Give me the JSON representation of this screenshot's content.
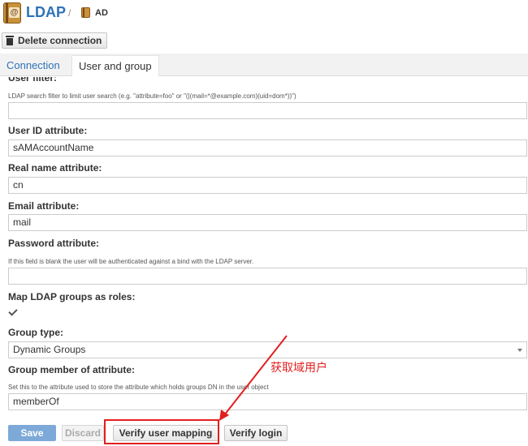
{
  "header": {
    "app_title": "LDAP",
    "breadcrumb_sep": "/",
    "breadcrumb_item": "AD",
    "app_icon_glyph": "@"
  },
  "toolbar": {
    "delete_label": "Delete connection"
  },
  "tabs": [
    {
      "label": "Connection",
      "active": false
    },
    {
      "label": "User and group",
      "active": true
    }
  ],
  "form": {
    "user_filter": {
      "label": "User filter:",
      "hint": "LDAP search filter to limit user search (e.g. \"attribute=foo\" or \"(|(mail=*@example.com)(uid=dom*))\")",
      "value": ""
    },
    "user_id": {
      "label": "User ID attribute:",
      "value": "sAMAccountName"
    },
    "real_name": {
      "label": "Real name attribute:",
      "value": "cn"
    },
    "email": {
      "label": "Email attribute:",
      "value": "mail"
    },
    "password": {
      "label": "Password attribute:",
      "hint": "If this field is blank the user will be authenticated against a bind with the LDAP server.",
      "value": ""
    },
    "map_groups": {
      "label": "Map LDAP groups as roles:",
      "checked": true
    },
    "group_type": {
      "label": "Group type:",
      "value": "Dynamic Groups"
    },
    "group_member": {
      "label": "Group member of attribute:",
      "hint": "Set this to the attribute used to store the attribute which holds groups DN in the user object",
      "value": "memberOf"
    }
  },
  "buttons": {
    "save": "Save",
    "discard": "Discard",
    "verify_mapping": "Verify user mapping",
    "verify_login": "Verify login"
  },
  "annotation": {
    "text": "获取域用户",
    "color": "#e21f1f"
  },
  "colors": {
    "accent": "#2e73b8",
    "save_button": "#7da9d8"
  },
  "icons": {
    "app": "ldap-book-icon",
    "breadcrumb": "book-icon",
    "delete": "trash-icon",
    "checkbox": "checkmark-icon",
    "select": "caret-down-icon"
  }
}
